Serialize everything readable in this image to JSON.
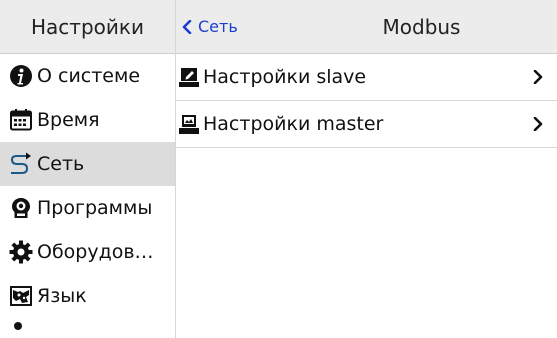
{
  "sidebar": {
    "title": "Настройки",
    "items": [
      {
        "label": "О системе",
        "icon": "info-icon"
      },
      {
        "label": "Время",
        "icon": "calendar-icon"
      },
      {
        "label": "Сеть",
        "icon": "network-icon",
        "active": true
      },
      {
        "label": "Программы",
        "icon": "programs-icon"
      },
      {
        "label": "Оборудов…",
        "icon": "gear-icon"
      },
      {
        "label": "Язык",
        "icon": "language-icon"
      }
    ]
  },
  "header": {
    "back_label": "Сеть",
    "title": "Modbus"
  },
  "list": {
    "items": [
      {
        "label": "Настройки slave",
        "icon": "slave-icon"
      },
      {
        "label": "Настройки master",
        "icon": "master-icon"
      }
    ]
  },
  "colors": {
    "accent": "#1a3fd0",
    "header_bg": "#ececec",
    "active_bg": "#dcdcdc"
  }
}
